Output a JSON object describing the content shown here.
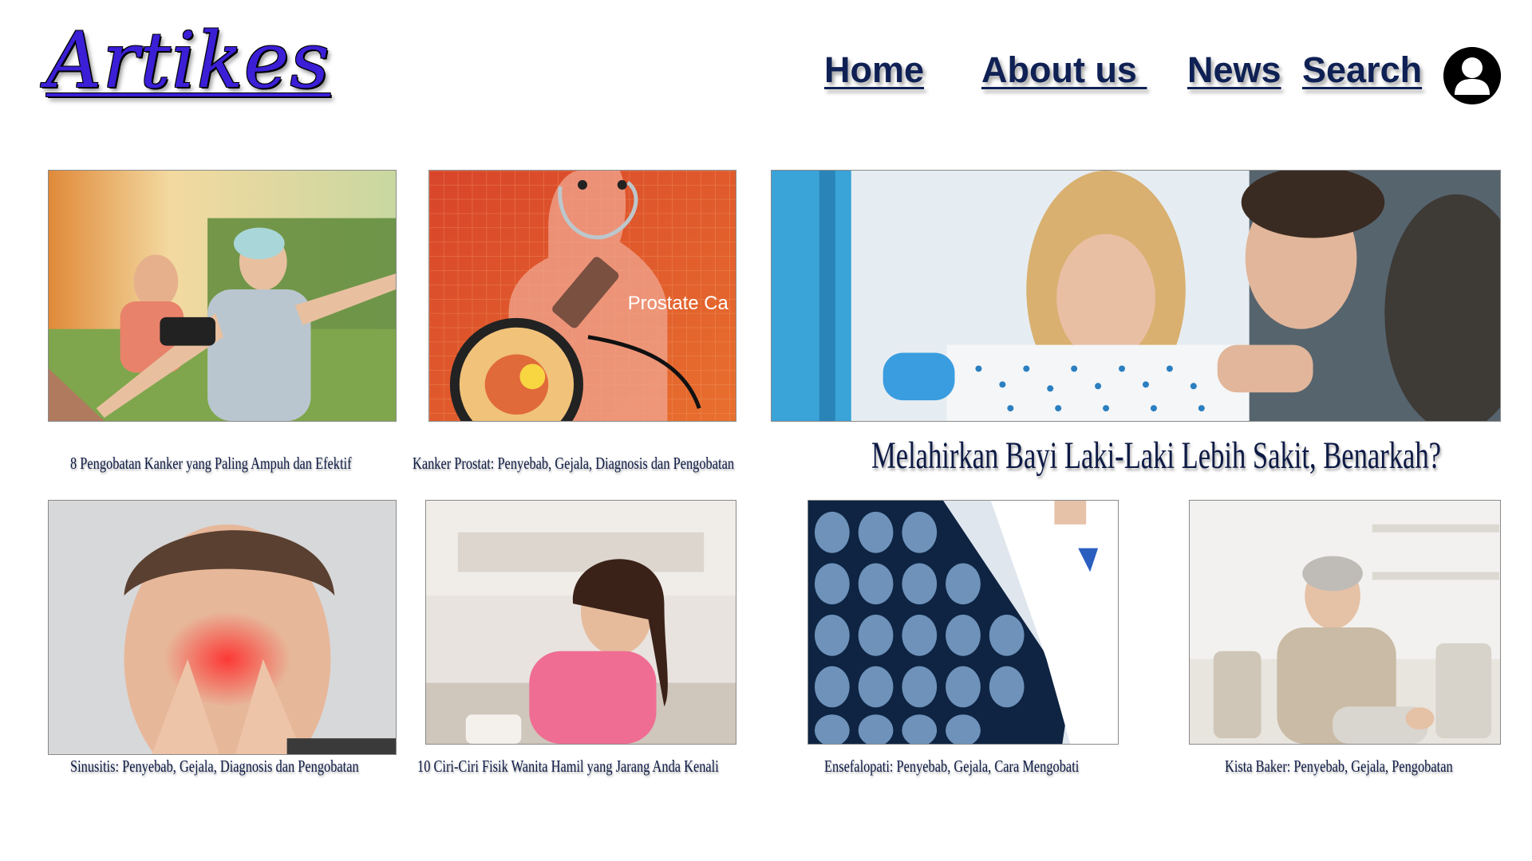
{
  "header": {
    "logo_text": "Artikes",
    "nav": {
      "home": "Home",
      "about": "About us ",
      "news": "News",
      "search": "Search"
    },
    "profile_icon": "user-circle-icon"
  },
  "articles": [
    {
      "title": "8 Pengobatan Kanker yang Paling Ampuh dan Efektif",
      "image": "cancer-patient-photo"
    },
    {
      "title": "Kanker Prostat: Penyebab, Gejala, Diagnosis dan Pengobatan",
      "image": "prostate-cancer-illustration",
      "image_text": "Prostate Ca"
    },
    {
      "title": "Melahirkan Bayi Laki-Laki Lebih Sakit, Benarkah?",
      "image": "childbirth-photo"
    },
    {
      "title": "Sinusitis: Penyebab, Gejala, Diagnosis dan Pengobatan",
      "image": "sinus-pain-photo"
    },
    {
      "title": "10 Ciri-Ciri Fisik Wanita Hamil yang Jarang Anda Kenali",
      "image": "nausea-woman-photo"
    },
    {
      "title": "Ensefalopati: Penyebab, Gejala, Cara Mengobati",
      "image": "brain-scan-photo"
    },
    {
      "title": "Kista Baker: Penyebab, Gejala, Pengobatan",
      "image": "knee-pain-photo"
    }
  ],
  "colors": {
    "logo": "#3a1fd6",
    "nav_text": "#0f2154",
    "caption_text": "#0d1a45"
  }
}
